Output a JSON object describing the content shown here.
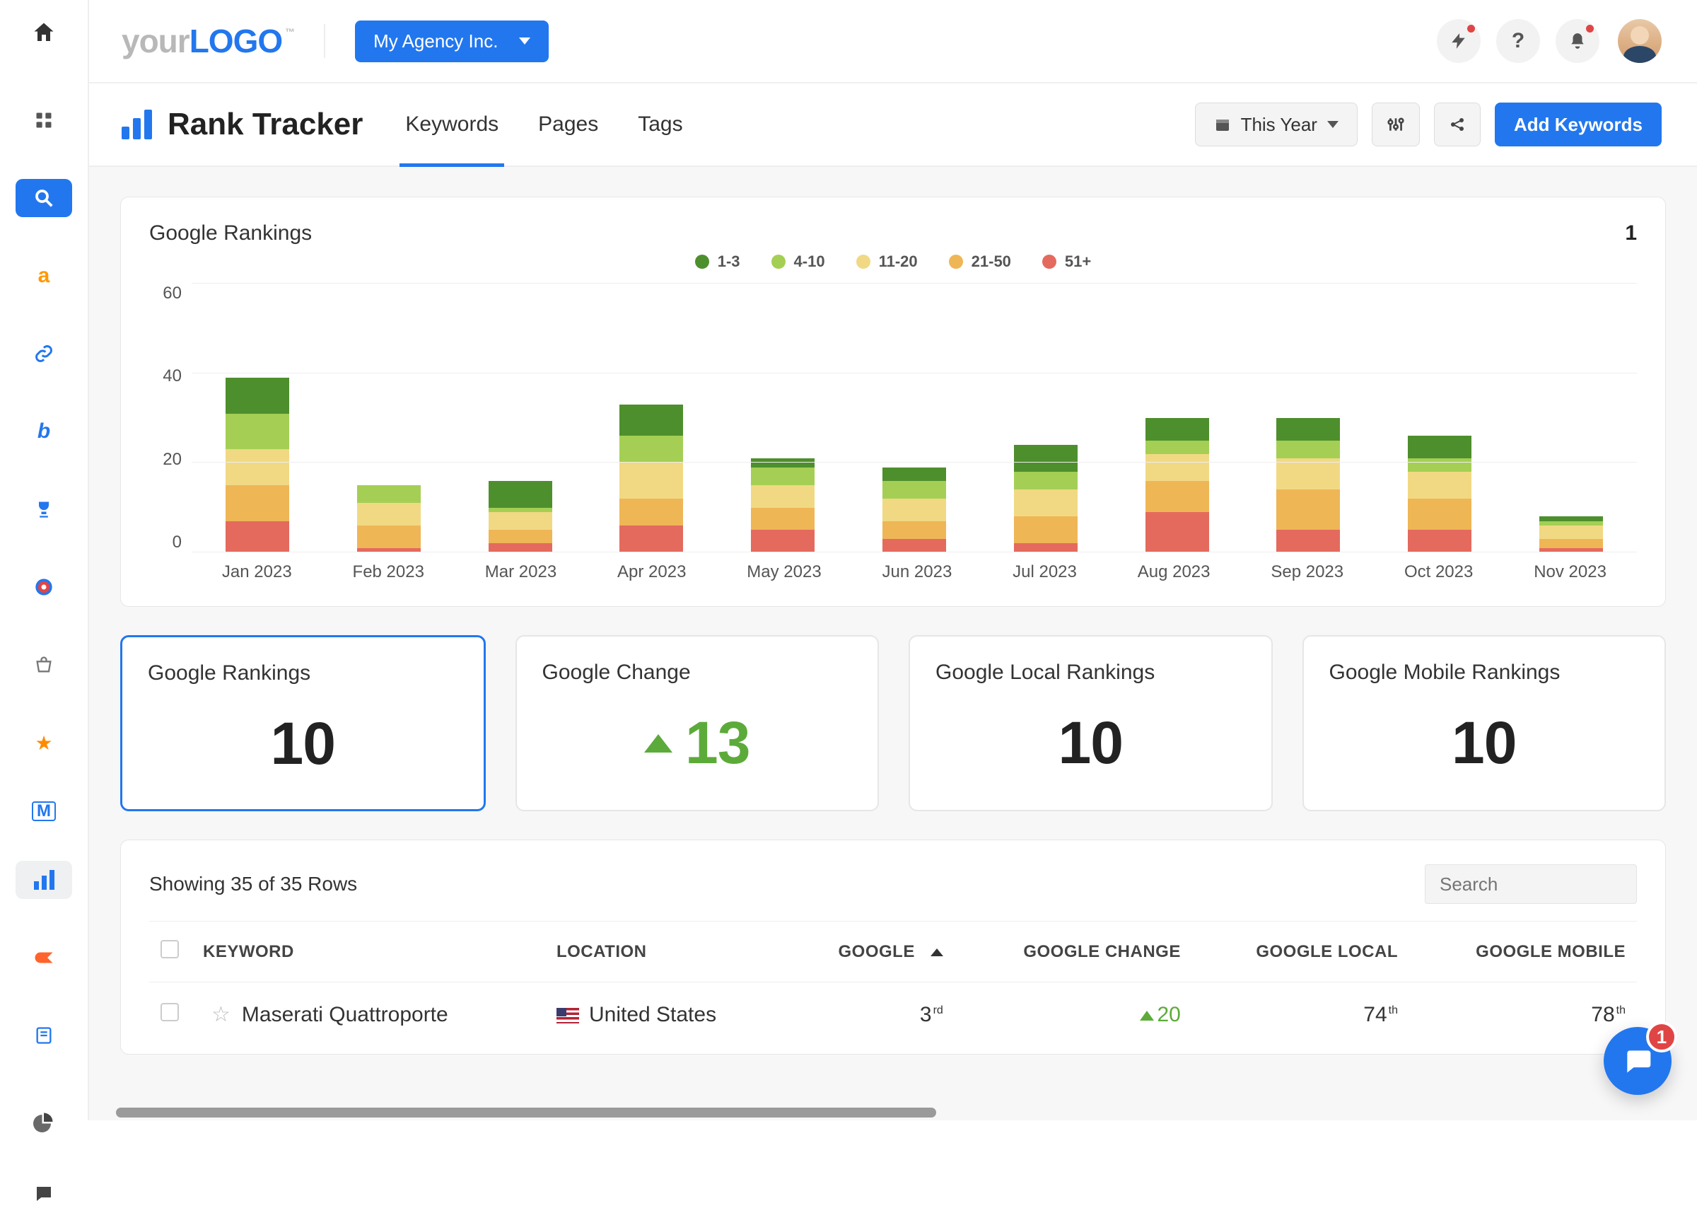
{
  "header": {
    "logo_your": "your",
    "logo_main": "LOGO",
    "logo_tm": "™",
    "agency_label": "My Agency Inc."
  },
  "page": {
    "title": "Rank Tracker",
    "tabs": [
      "Keywords",
      "Pages",
      "Tags"
    ],
    "active_tab_index": 0,
    "date_range_label": "This Year",
    "add_button_label": "Add Keywords"
  },
  "chart_card": {
    "title": "Google Rankings",
    "badge": "1"
  },
  "chart_data": {
    "type": "bar",
    "stacked": true,
    "title": "Google Rankings",
    "ylabel": "",
    "xlabel": "",
    "ylim": [
      0,
      60
    ],
    "yticks": [
      0,
      20,
      40,
      60
    ],
    "categories": [
      "Jan 2023",
      "Feb 2023",
      "Mar 2023",
      "Apr 2023",
      "May 2023",
      "Jun 2023",
      "Jul 2023",
      "Aug 2023",
      "Sep 2023",
      "Oct 2023",
      "Nov 2023"
    ],
    "series": [
      {
        "name": "1-3",
        "color": "#4e8f2d",
        "values": [
          8,
          0,
          6,
          7,
          2,
          3,
          6,
          5,
          5,
          5,
          1
        ]
      },
      {
        "name": "4-10",
        "color": "#a4cf54",
        "values": [
          8,
          4,
          1,
          6,
          4,
          4,
          4,
          3,
          4,
          3,
          1
        ]
      },
      {
        "name": "11-20",
        "color": "#f1d984",
        "values": [
          8,
          5,
          4,
          8,
          5,
          5,
          6,
          6,
          7,
          6,
          3
        ]
      },
      {
        "name": "21-50",
        "color": "#efb656",
        "values": [
          8,
          5,
          3,
          6,
          5,
          4,
          6,
          7,
          9,
          7,
          2
        ]
      },
      {
        "name": "51+",
        "color": "#e46a5e",
        "values": [
          7,
          1,
          2,
          6,
          5,
          3,
          2,
          9,
          5,
          5,
          1
        ]
      }
    ]
  },
  "metrics": [
    {
      "title": "Google Rankings",
      "value": "10",
      "active": true
    },
    {
      "title": "Google Change",
      "value": "13",
      "trend": "up"
    },
    {
      "title": "Google Local Rankings",
      "value": "10"
    },
    {
      "title": "Google Mobile Rankings",
      "value": "10"
    }
  ],
  "table": {
    "rows_text": "Showing 35 of 35 Rows",
    "search_placeholder": "Search",
    "columns": [
      "KEYWORD",
      "LOCATION",
      "GOOGLE",
      "GOOGLE CHANGE",
      "GOOGLE LOCAL",
      "GOOGLE MOBILE"
    ],
    "sort_column_index": 2,
    "sort_direction": "asc",
    "rows": [
      {
        "keyword": "Maserati Quattroporte",
        "location": "United States",
        "google_rank": 3,
        "google_ord": "rd",
        "google_change": 20,
        "google_change_dir": "up",
        "local_rank": 74,
        "local_ord": "th",
        "mobile_rank": 78,
        "mobile_ord": "th"
      }
    ]
  },
  "chat": {
    "badge": "1"
  },
  "colors": {
    "primary": "#2277ee",
    "green": "#5cab3a",
    "red": "#e04545"
  }
}
